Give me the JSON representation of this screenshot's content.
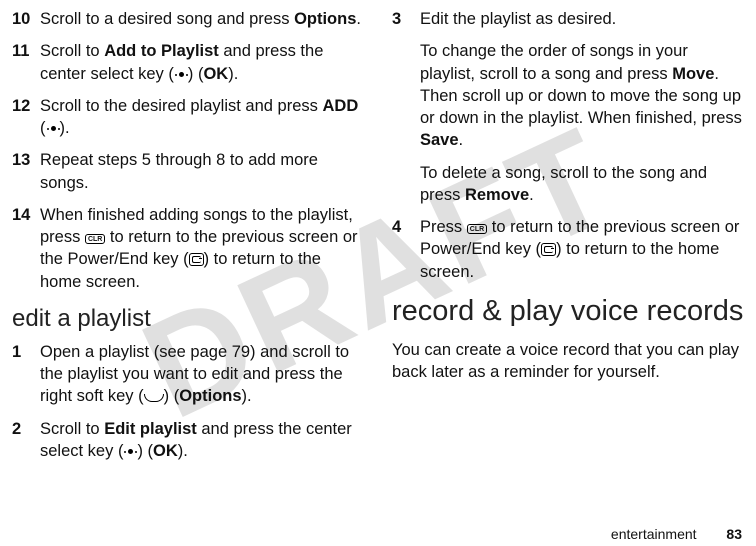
{
  "watermark": "DRAFT",
  "left": {
    "steps_a": [
      {
        "num": "10",
        "parts": [
          "Scroll to a desired song and press ",
          {
            "cond": "Options"
          },
          "."
        ]
      },
      {
        "num": "11",
        "parts": [
          "Scroll to ",
          {
            "cond": "Add to Playlist"
          },
          " and press the center select key (",
          {
            "icon": "dot"
          },
          ") (",
          {
            "cond": "OK"
          },
          ")."
        ]
      },
      {
        "num": "12",
        "parts": [
          "Scroll to the desired playlist and press ",
          {
            "cond": "ADD"
          },
          " (",
          {
            "icon": "dot"
          },
          ")."
        ]
      },
      {
        "num": "13",
        "parts": [
          "Repeat steps 5 through 8 to add more songs."
        ]
      },
      {
        "num": "14",
        "parts": [
          "When finished adding songs to the playlist, press ",
          {
            "icon": "clr"
          },
          " to return to the previous screen or the Power/End key (",
          {
            "icon": "end"
          },
          ") to return to the home screen."
        ]
      }
    ],
    "heading": "edit a playlist",
    "steps_b": [
      {
        "num": "1",
        "parts": [
          "Open a playlist (see page 79) and scroll to the playlist you want to edit and press the right soft key (",
          {
            "icon": "soft"
          },
          ") (",
          {
            "cond": "Options"
          },
          ")."
        ]
      },
      {
        "num": "2",
        "parts": [
          "Scroll to ",
          {
            "cond": "Edit playlist"
          },
          " and press the center select key (",
          {
            "icon": "dot"
          },
          ") (",
          {
            "cond": "OK"
          },
          ")."
        ]
      }
    ]
  },
  "right": {
    "steps": [
      {
        "num": "3",
        "parts": [
          "Edit the playlist as desired."
        ]
      }
    ],
    "para1": [
      "To change the order of songs in your playlist, scroll to a song and press ",
      {
        "cond": "Move"
      },
      ". Then scroll up or down to move the song up or down in the playlist. When finished, press ",
      {
        "cond": "Save"
      },
      "."
    ],
    "para2": [
      "To delete a song, scroll to the song and press ",
      {
        "cond": "Remove"
      },
      "."
    ],
    "steps2": [
      {
        "num": "4",
        "parts": [
          "Press ",
          {
            "icon": "clr"
          },
          " to return to the previous screen or Power/End key (",
          {
            "icon": "end"
          },
          ") to return to the home screen."
        ]
      }
    ],
    "heading": "record & play voice records",
    "body": "You can create a voice record that you can play back later as a reminder for yourself."
  },
  "footer": {
    "section": "entertainment",
    "page": "83"
  },
  "icons": {
    "clr_label": "CLR"
  }
}
